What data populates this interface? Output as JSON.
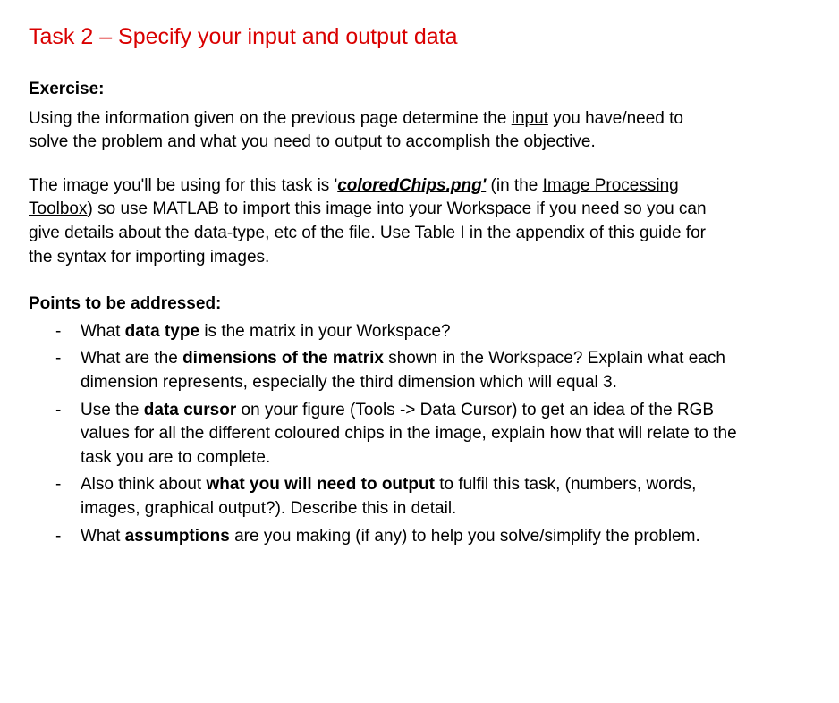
{
  "title": "Task 2 – Specify your input and output data",
  "exercise": {
    "heading": "Exercise:",
    "p1_a": "Using the information given on the previous page determine the ",
    "p1_input": "input",
    "p1_b": " you have/need to solve the problem and what you need to ",
    "p1_output": "output",
    "p1_c": " to accomplish the objective.",
    "p2_a": "The image you'll be using for this task is ",
    "p2_file_open": "'",
    "p2_file": "coloredChips.png'",
    "p2_b": " (in the ",
    "p2_toolbox": "Image Processing Toolbox",
    "p2_c": ") so use MATLAB to import this image into your Workspace if you need so you can give details about the data-type, etc of the file. Use Table I in the appendix of this guide for the syntax for importing images."
  },
  "points": {
    "heading": "Points to be addressed:",
    "items": [
      {
        "pre": "What ",
        "bold": "data type",
        "post": " is the matrix in your Workspace?"
      },
      {
        "pre": "What are the ",
        "bold": "dimensions of the matrix",
        "post": " shown in the Workspace? Explain what each dimension represents, especially the third dimension which will equal 3."
      },
      {
        "pre": "Use the ",
        "bold": "data cursor",
        "post": " on your figure (Tools -> Data Cursor) to get an idea of the RGB values for all the different coloured chips in the image, explain how that will relate to the task you are to complete."
      },
      {
        "pre": "Also think about ",
        "bold": "what you will need to output",
        "post": " to fulfil this task, (numbers, words, images, graphical output?). Describe this in detail."
      },
      {
        "pre": "What ",
        "bold": "assumptions",
        "post": " are you making (if any) to help you solve/simplify the problem."
      }
    ]
  }
}
